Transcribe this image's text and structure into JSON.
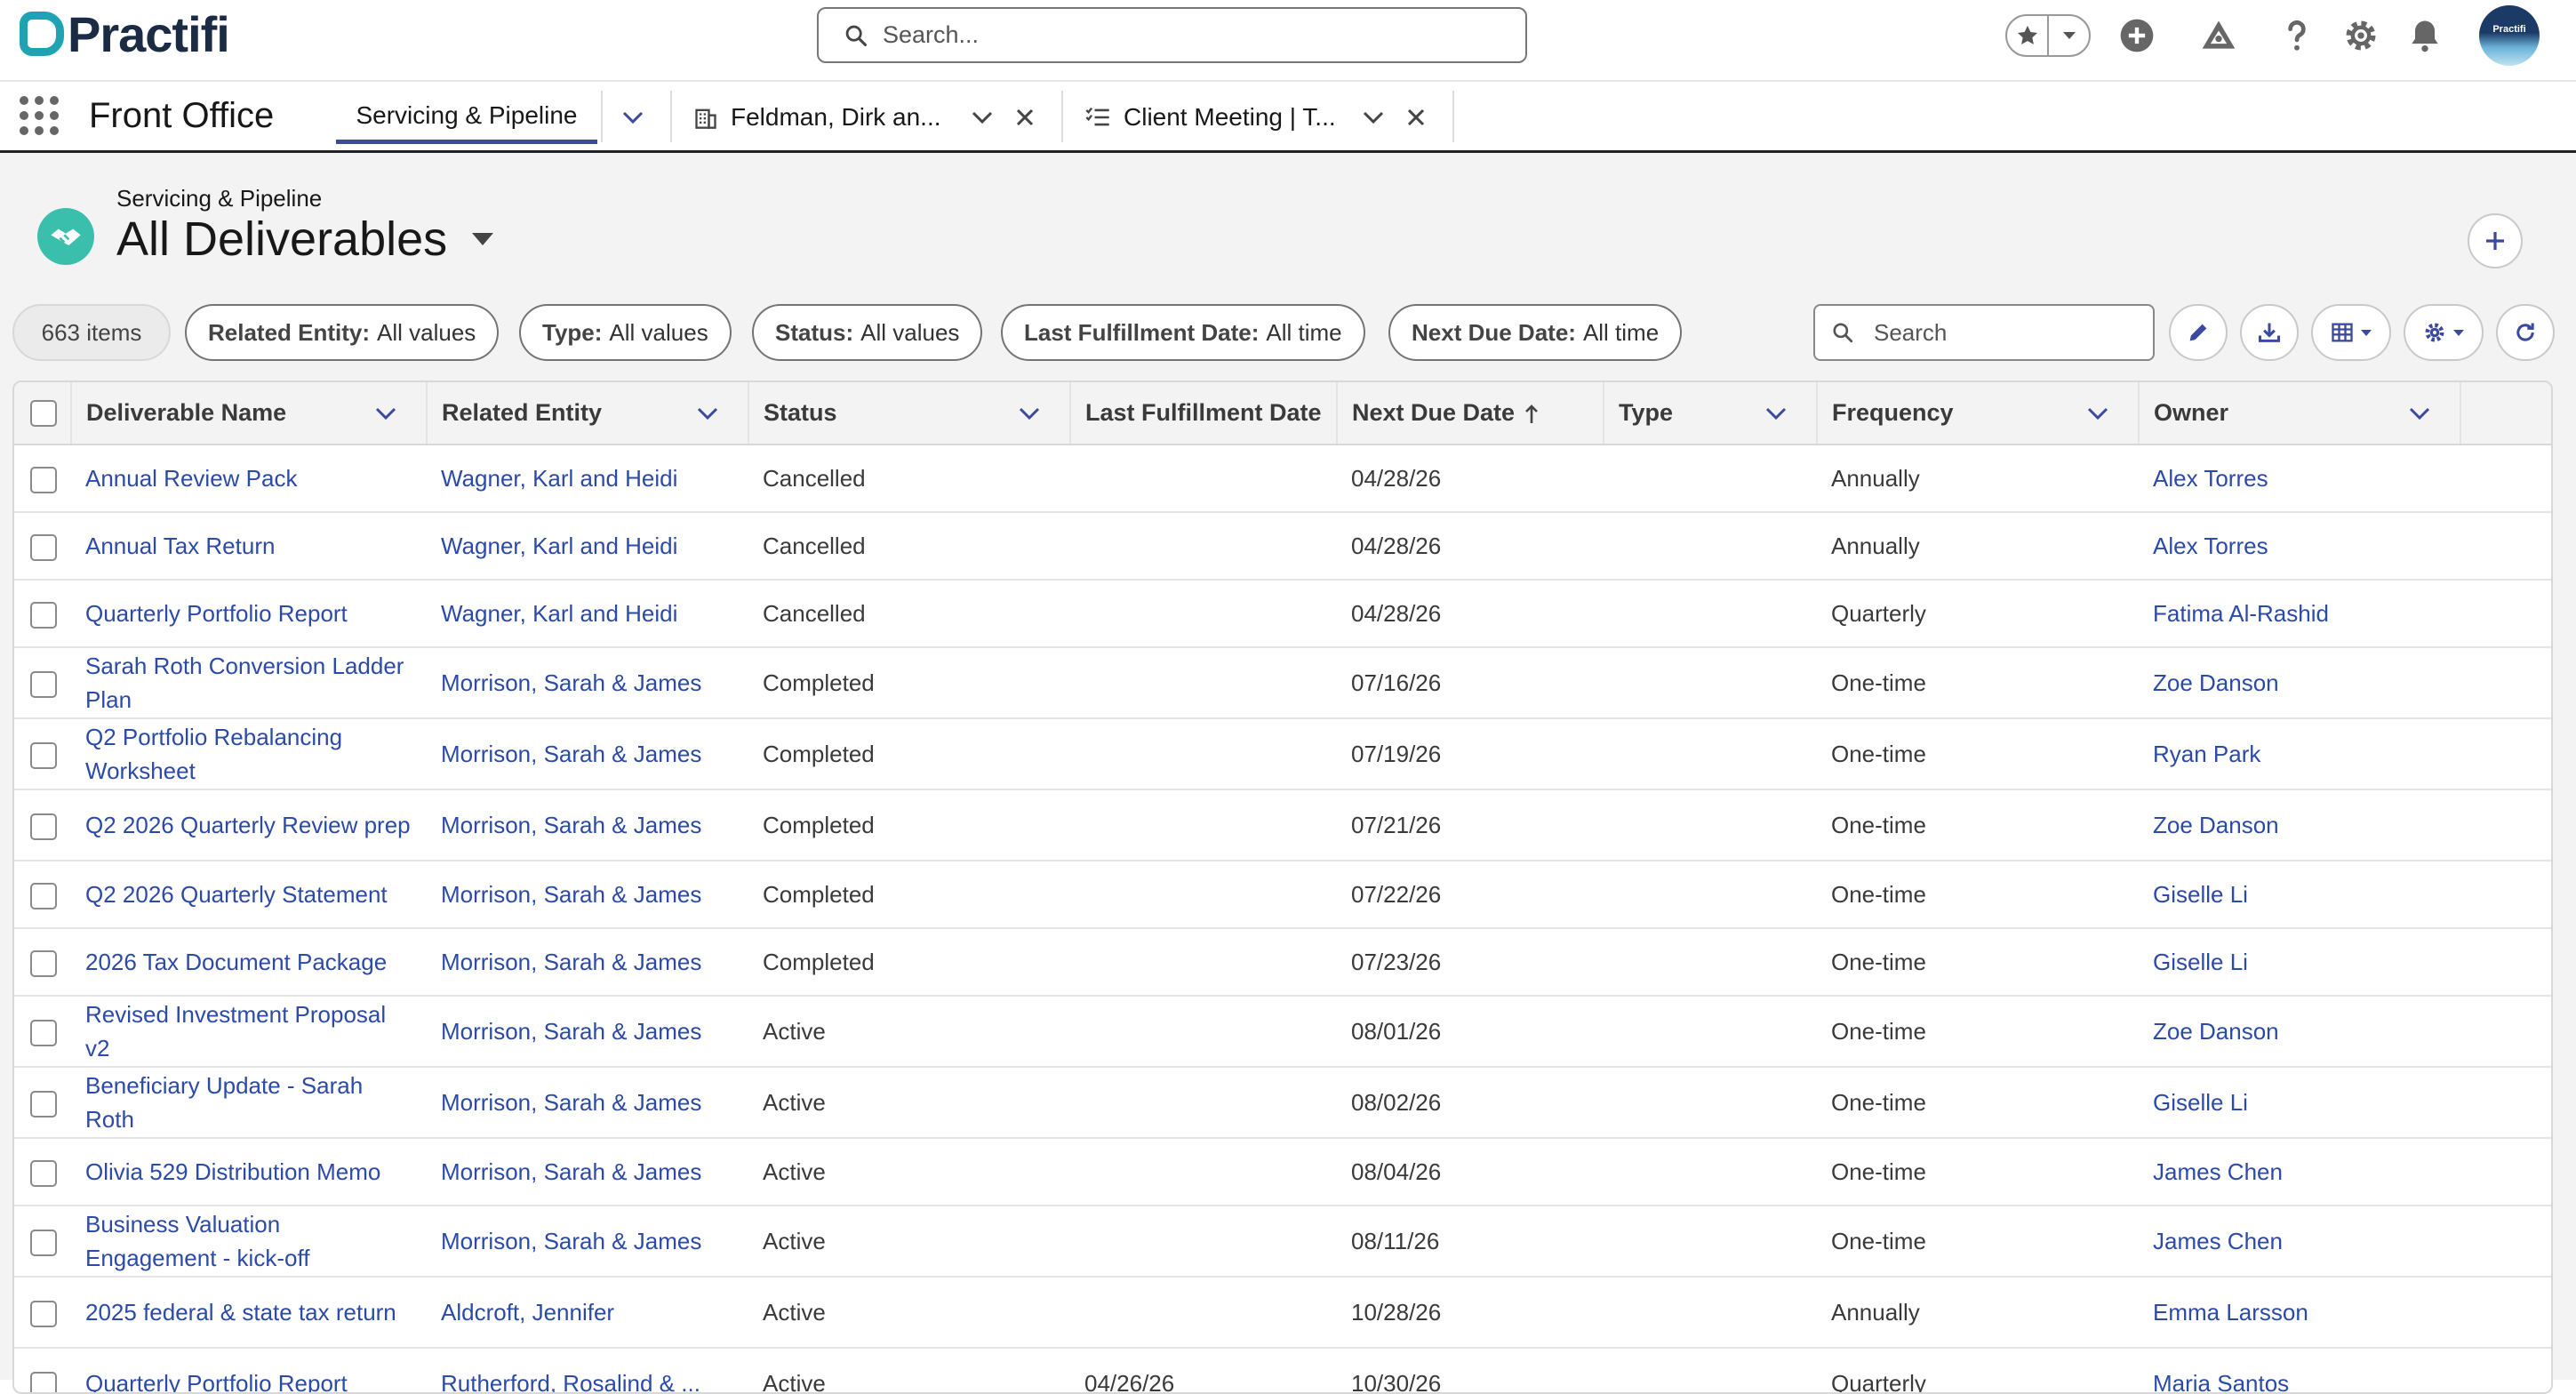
{
  "brand": {
    "name": "Practifi"
  },
  "global_search": {
    "placeholder": "Search..."
  },
  "nav": {
    "app_name": "Front Office",
    "tabs": [
      {
        "label": "Servicing & Pipeline"
      },
      {
        "label": "Feldman, Dirk an..."
      },
      {
        "label": "Client Meeting | T..."
      }
    ]
  },
  "page_header": {
    "subtitle": "Servicing & Pipeline",
    "title": "All Deliverables"
  },
  "filters": {
    "count": "663 items",
    "items": [
      {
        "key": "Related Entity:",
        "value": "All values"
      },
      {
        "key": "Type:",
        "value": "All values"
      },
      {
        "key": "Status:",
        "value": "All values"
      },
      {
        "key": "Last Fulfillment Date:",
        "value": "All time"
      },
      {
        "key": "Next Due Date:",
        "value": "All time"
      }
    ],
    "search_placeholder": "Search"
  },
  "table": {
    "columns": [
      "Deliverable Name",
      "Related Entity",
      "Status",
      "Last Fulfillment Date",
      "Next Due Date",
      "Type",
      "Frequency",
      "Owner"
    ],
    "rows": [
      {
        "name": "Annual Review Pack",
        "entity": "Wagner, Karl and Heidi",
        "status": "Cancelled",
        "last": "",
        "next": "04/28/26",
        "type": "",
        "freq": "Annually",
        "owner": "Alex Torres"
      },
      {
        "name": "Annual Tax Return",
        "entity": "Wagner, Karl and Heidi",
        "status": "Cancelled",
        "last": "",
        "next": "04/28/26",
        "type": "",
        "freq": "Annually",
        "owner": "Alex Torres"
      },
      {
        "name": "Quarterly Portfolio Report",
        "entity": "Wagner, Karl and Heidi",
        "status": "Cancelled",
        "last": "",
        "next": "04/28/26",
        "type": "",
        "freq": "Quarterly",
        "owner": "Fatima Al-Rashid"
      },
      {
        "name": "Sarah Roth Conversion Ladder Plan",
        "entity": "Morrison, Sarah & James",
        "status": "Completed",
        "last": "",
        "next": "07/16/26",
        "type": "",
        "freq": "One-time",
        "owner": "Zoe Danson"
      },
      {
        "name": "Q2 Portfolio Rebalancing Worksheet",
        "entity": "Morrison, Sarah & James",
        "status": "Completed",
        "last": "",
        "next": "07/19/26",
        "type": "",
        "freq": "One-time",
        "owner": "Ryan Park"
      },
      {
        "name": "Q2 2026 Quarterly Review prep",
        "entity": "Morrison, Sarah & James",
        "status": "Completed",
        "last": "",
        "next": "07/21/26",
        "type": "",
        "freq": "One-time",
        "owner": "Zoe Danson"
      },
      {
        "name": "Q2 2026 Quarterly Statement",
        "entity": "Morrison, Sarah & James",
        "status": "Completed",
        "last": "",
        "next": "07/22/26",
        "type": "",
        "freq": "One-time",
        "owner": "Giselle Li"
      },
      {
        "name": "2026 Tax Document Package",
        "entity": "Morrison, Sarah & James",
        "status": "Completed",
        "last": "",
        "next": "07/23/26",
        "type": "",
        "freq": "One-time",
        "owner": "Giselle Li"
      },
      {
        "name": "Revised Investment Proposal v2",
        "entity": "Morrison, Sarah & James",
        "status": "Active",
        "last": "",
        "next": "08/01/26",
        "type": "",
        "freq": "One-time",
        "owner": "Zoe Danson"
      },
      {
        "name": "Beneficiary Update - Sarah Roth",
        "entity": "Morrison, Sarah & James",
        "status": "Active",
        "last": "",
        "next": "08/02/26",
        "type": "",
        "freq": "One-time",
        "owner": "Giselle Li"
      },
      {
        "name": "Olivia 529 Distribution Memo",
        "entity": "Morrison, Sarah & James",
        "status": "Active",
        "last": "",
        "next": "08/04/26",
        "type": "",
        "freq": "One-time",
        "owner": "James Chen"
      },
      {
        "name": "Business Valuation Engagement - kick-off",
        "entity": "Morrison, Sarah & James",
        "status": "Active",
        "last": "",
        "next": "08/11/26",
        "type": "",
        "freq": "One-time",
        "owner": "James Chen"
      },
      {
        "name": "2025 federal & state tax return",
        "entity": "Aldcroft, Jennifer",
        "status": "Active",
        "last": "",
        "next": "10/28/26",
        "type": "",
        "freq": "Annually",
        "owner": "Emma Larsson"
      },
      {
        "name": "Quarterly Portfolio Report",
        "entity": "Rutherford, Rosalind & ...",
        "status": "Active",
        "last": "04/26/26",
        "next": "10/30/26",
        "type": "",
        "freq": "Quarterly",
        "owner": "Maria Santos"
      }
    ]
  }
}
